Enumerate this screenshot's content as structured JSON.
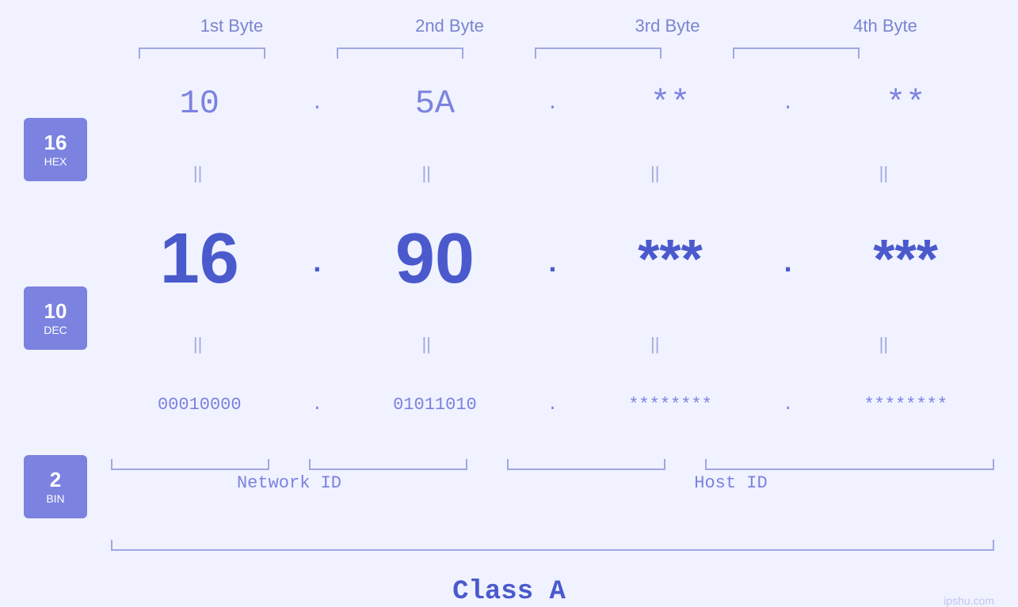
{
  "header": {
    "bytes": [
      "1st Byte",
      "2nd Byte",
      "3rd Byte",
      "4th Byte"
    ]
  },
  "badges": [
    {
      "num": "16",
      "label": "HEX"
    },
    {
      "num": "10",
      "label": "DEC"
    },
    {
      "num": "2",
      "label": "BIN"
    }
  ],
  "hex_row": {
    "b1": "10",
    "b2": "5A",
    "b3": "**",
    "b4": "**",
    "dot": "."
  },
  "dec_row": {
    "b1": "16",
    "b2": "90",
    "b3": "***",
    "b4": "***",
    "dot": "."
  },
  "bin_row": {
    "b1": "00010000",
    "b2": "01011010",
    "b3": "********",
    "b4": "********",
    "dot": "."
  },
  "labels": {
    "network_id": "Network ID",
    "host_id": "Host ID",
    "class": "Class A"
  },
  "watermark": "ipshu.com"
}
